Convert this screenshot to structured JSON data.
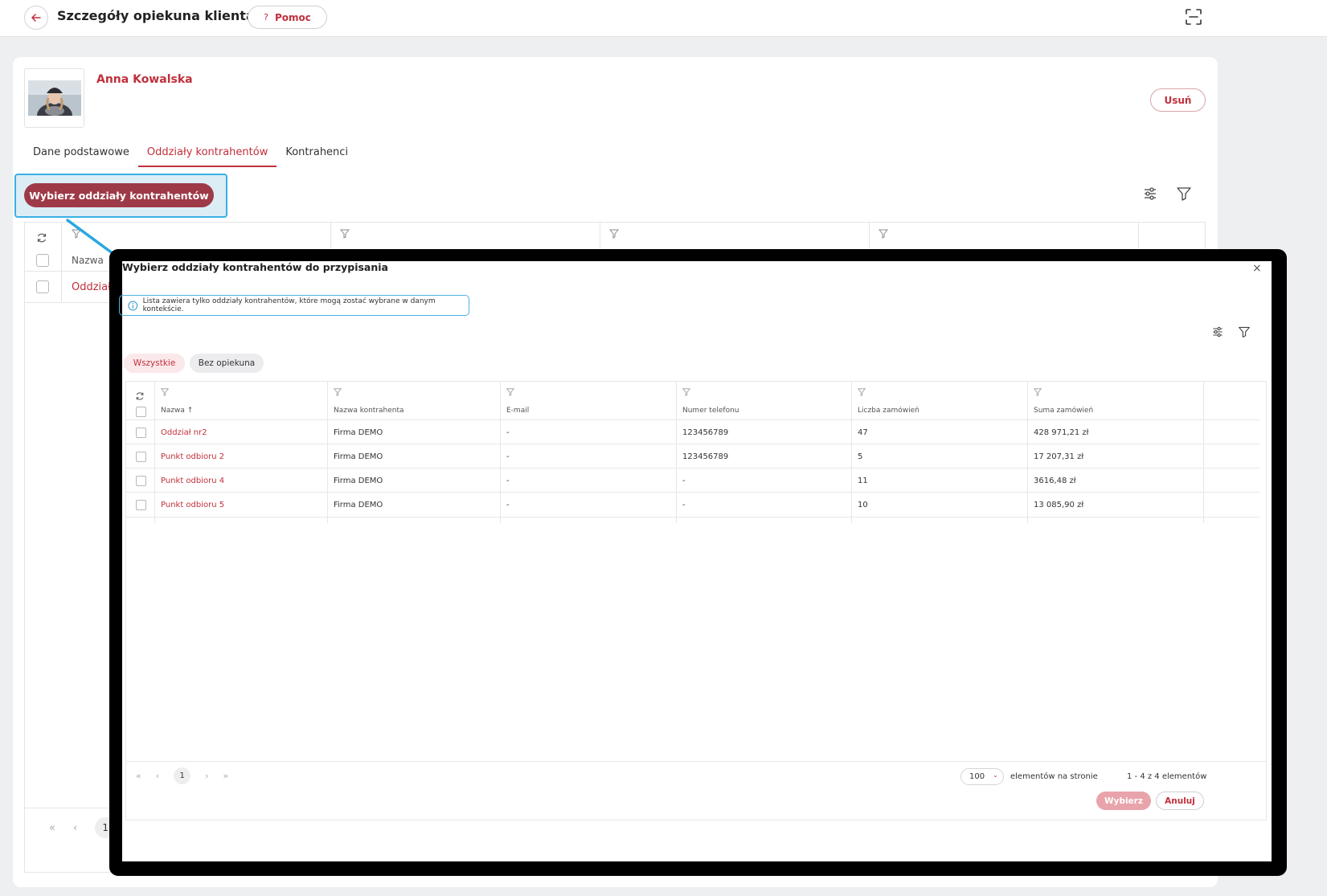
{
  "header": {
    "title": "Szczegóły opiekuna klienta",
    "help_label": "Pomoc",
    "help_glyph": "?"
  },
  "profile": {
    "name": "Anna Kowalska",
    "delete_label": "Usuń"
  },
  "tabs": [
    {
      "label": "Dane podstawowe",
      "active": false
    },
    {
      "label": "Oddziały kontrahentów",
      "active": true
    },
    {
      "label": "Kontrahenci",
      "active": false
    }
  ],
  "background_table": {
    "choose_button": "Wybierz oddziały kontrahentów",
    "name_header": "Nazwa",
    "row_label": "Oddział",
    "page": "1"
  },
  "modal": {
    "title": "Wybierz oddziały kontrahentów do przypisania",
    "close_glyph": "×",
    "info": "Lista zawiera tylko oddziały kontrahentów, które mogą zostać wybrane w danym kontekście.",
    "filters": {
      "all": "Wszystkie",
      "no_owner": "Bez opiekuna"
    },
    "columns": [
      "Nazwa ↑",
      "Nazwa kontrahenta",
      "E-mail",
      "Numer telefonu",
      "Liczba zamówień",
      "Suma zamówień"
    ],
    "rows": [
      [
        "Oddział nr2",
        "Firma DEMO",
        "-",
        "123456789",
        "47",
        "428 971,21 zł"
      ],
      [
        "Punkt odbioru 2",
        "Firma DEMO",
        "-",
        "123456789",
        "5",
        "17 207,31 zł"
      ],
      [
        "Punkt odbioru 4",
        "Firma DEMO",
        "-",
        "-",
        "11",
        "3616,48 zł"
      ],
      [
        "Punkt odbioru 5",
        "Firma DEMO",
        "-",
        "-",
        "10",
        "13 085,90 zł"
      ]
    ],
    "pager": {
      "first": "«",
      "prev": "‹",
      "page": "1",
      "next": "›",
      "last": "»",
      "page_size": "100",
      "per_page_label": "elementów na stronie",
      "count_label": "1 - 4 z 4 elementów"
    },
    "select_label": "Wybierz",
    "cancel_label": "Anuluj"
  },
  "colors": {
    "accent": "#c0303c",
    "primary_button": "#9e3a48",
    "highlight": "#3ab0e4"
  }
}
